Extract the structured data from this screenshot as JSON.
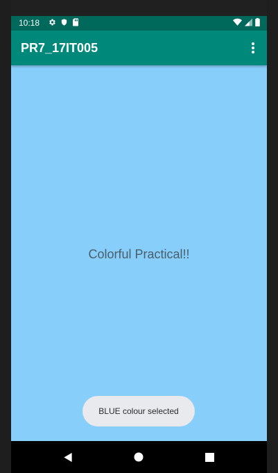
{
  "status_bar": {
    "time": "10:18",
    "left_icons": [
      "settings-icon",
      "shield-icon",
      "sd-card-icon"
    ],
    "right_icons": [
      "wifi-icon",
      "signal-icon",
      "battery-icon"
    ]
  },
  "app_bar": {
    "title": "PR7_17IT005",
    "overflow_icon": "more-vert-icon"
  },
  "main": {
    "center_text": "Colorful Practical!!",
    "background_color": "#87cefa"
  },
  "toast": {
    "message": "BLUE colour selected"
  },
  "nav_bar": {
    "buttons": [
      "back-icon",
      "home-icon",
      "recents-icon"
    ]
  },
  "colors": {
    "status_bar": "#00695c",
    "app_bar": "#00897b",
    "content_background": "#87cefa",
    "toast_background": "#e8eaed"
  }
}
